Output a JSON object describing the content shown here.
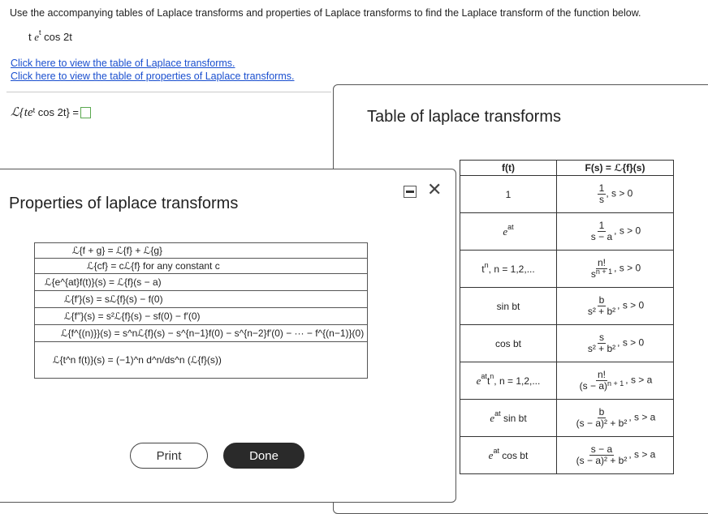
{
  "question": {
    "instruction": "Use the accompanying tables of Laplace transforms and properties of Laplace transforms to find the Laplace transform of the function below.",
    "function_parts": [
      "t",
      "e",
      "t",
      "cos 2t"
    ],
    "link_transforms": "Click here to view the table of Laplace transforms.",
    "link_properties": "Click here to view the table of properties of Laplace transforms.",
    "answer_lhs": "ℒ{te",
    "answer_sup": "t",
    "answer_rhs": "cos 2t} =",
    "answer_value": ""
  },
  "laplace_panel": {
    "title": "Table of laplace transforms",
    "header_f": "f(t)",
    "header_F": "F(s) = ℒ{f}(s)",
    "rows": [
      {
        "f": "1",
        "F_num": "1",
        "F_den": "s",
        "cond": ", s > 0"
      },
      {
        "f": "e",
        "f_sup": "at",
        "F_num": "1",
        "F_den": "s − a",
        "cond": ", s > 0"
      },
      {
        "f": "t",
        "f_sup": "n",
        "f_tail": ", n = 1,2,...",
        "F_num": "n!",
        "F_den": "s",
        "F_den_sup": "n + 1",
        "cond": ", s > 0"
      },
      {
        "f": "sin bt",
        "F_num": "b",
        "F_den": "s² + b²",
        "cond": ", s > 0"
      },
      {
        "f": "cos bt",
        "F_num": "s",
        "F_den": "s² + b²",
        "cond": ", s > 0"
      },
      {
        "f": "e",
        "f_sup": "at",
        "f_tail": "t",
        "f_sup2": "n",
        "f_tail2": ", n = 1,2,...",
        "F_num": "n!",
        "F_den": "(s − a)",
        "F_den_sup": "n + 1",
        "cond": ", s > a"
      },
      {
        "f": "e",
        "f_sup": "at",
        "f_tail": " sin bt",
        "F_num": "b",
        "F_den": "(s − a)² + b²",
        "cond": ", s > a"
      },
      {
        "f": "e",
        "f_sup": "at",
        "f_tail": " cos bt",
        "F_num": "s − a",
        "F_den": "(s − a)² + b²",
        "cond": ", s > a"
      }
    ]
  },
  "properties_panel": {
    "title": "Properties of laplace transforms",
    "rows": [
      "ℒ{f + g} = ℒ{f} + ℒ{g}",
      "ℒ{cf} = cℒ{f} for any constant c",
      "ℒ{e^{at}f(t)}(s) = ℒ{f}(s − a)",
      "ℒ{f′}(s) = sℒ{f}(s) − f(0)",
      "ℒ{f″}(s) = s²ℒ{f}(s) − sf(0) − f′(0)",
      "ℒ{f^{(n)}}(s) = s^nℒ{f}(s) − s^{n−1}f(0) − s^{n−2}f′(0) − ··· − f^{(n−1)}(0)",
      "ℒ{t^n f(t)}(s) = (−1)^n d^n/ds^n (ℒ{f}(s))"
    ],
    "print_label": "Print",
    "done_label": "Done"
  }
}
